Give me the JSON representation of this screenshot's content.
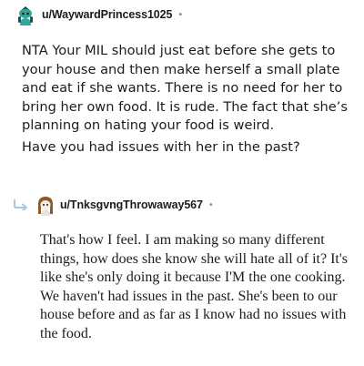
{
  "comments": [
    {
      "username": "u/WaywardPrincess1025",
      "avatar_icon": "snoo-avatar-teal-icon",
      "separator": "•",
      "paragraphs": [
        "NTA Your MIL should just eat before she gets to your house and then make herself a small plate and eat if she wants. There is no need for her to bring her own food. It is rude. The fact that she’s planning on hating your food is weird.",
        "Have you had issues with her in the past?"
      ]
    },
    {
      "username": "u/TnksgvngThrowaway567",
      "avatar_icon": "snoo-avatar-brown-hair-icon",
      "reply_icon": "reply-arrow-icon",
      "separator": "•",
      "paragraphs": [
        "That's how I feel. I am making so many different things, how does she know she will hate all of it? It's like she's only doing it because I'M the one cooking. We haven't had issues in the past. She's been to our house before and as far as I know had no issues with the food."
      ]
    }
  ],
  "colors": {
    "text": "#1c1c1c",
    "meta": "#878a8c",
    "avatar_teal": "#2fa89a",
    "avatar_dark": "#1f4f5c",
    "avatar_brown": "#8a5a2b",
    "reply_arrow": "#a8c7e0"
  }
}
